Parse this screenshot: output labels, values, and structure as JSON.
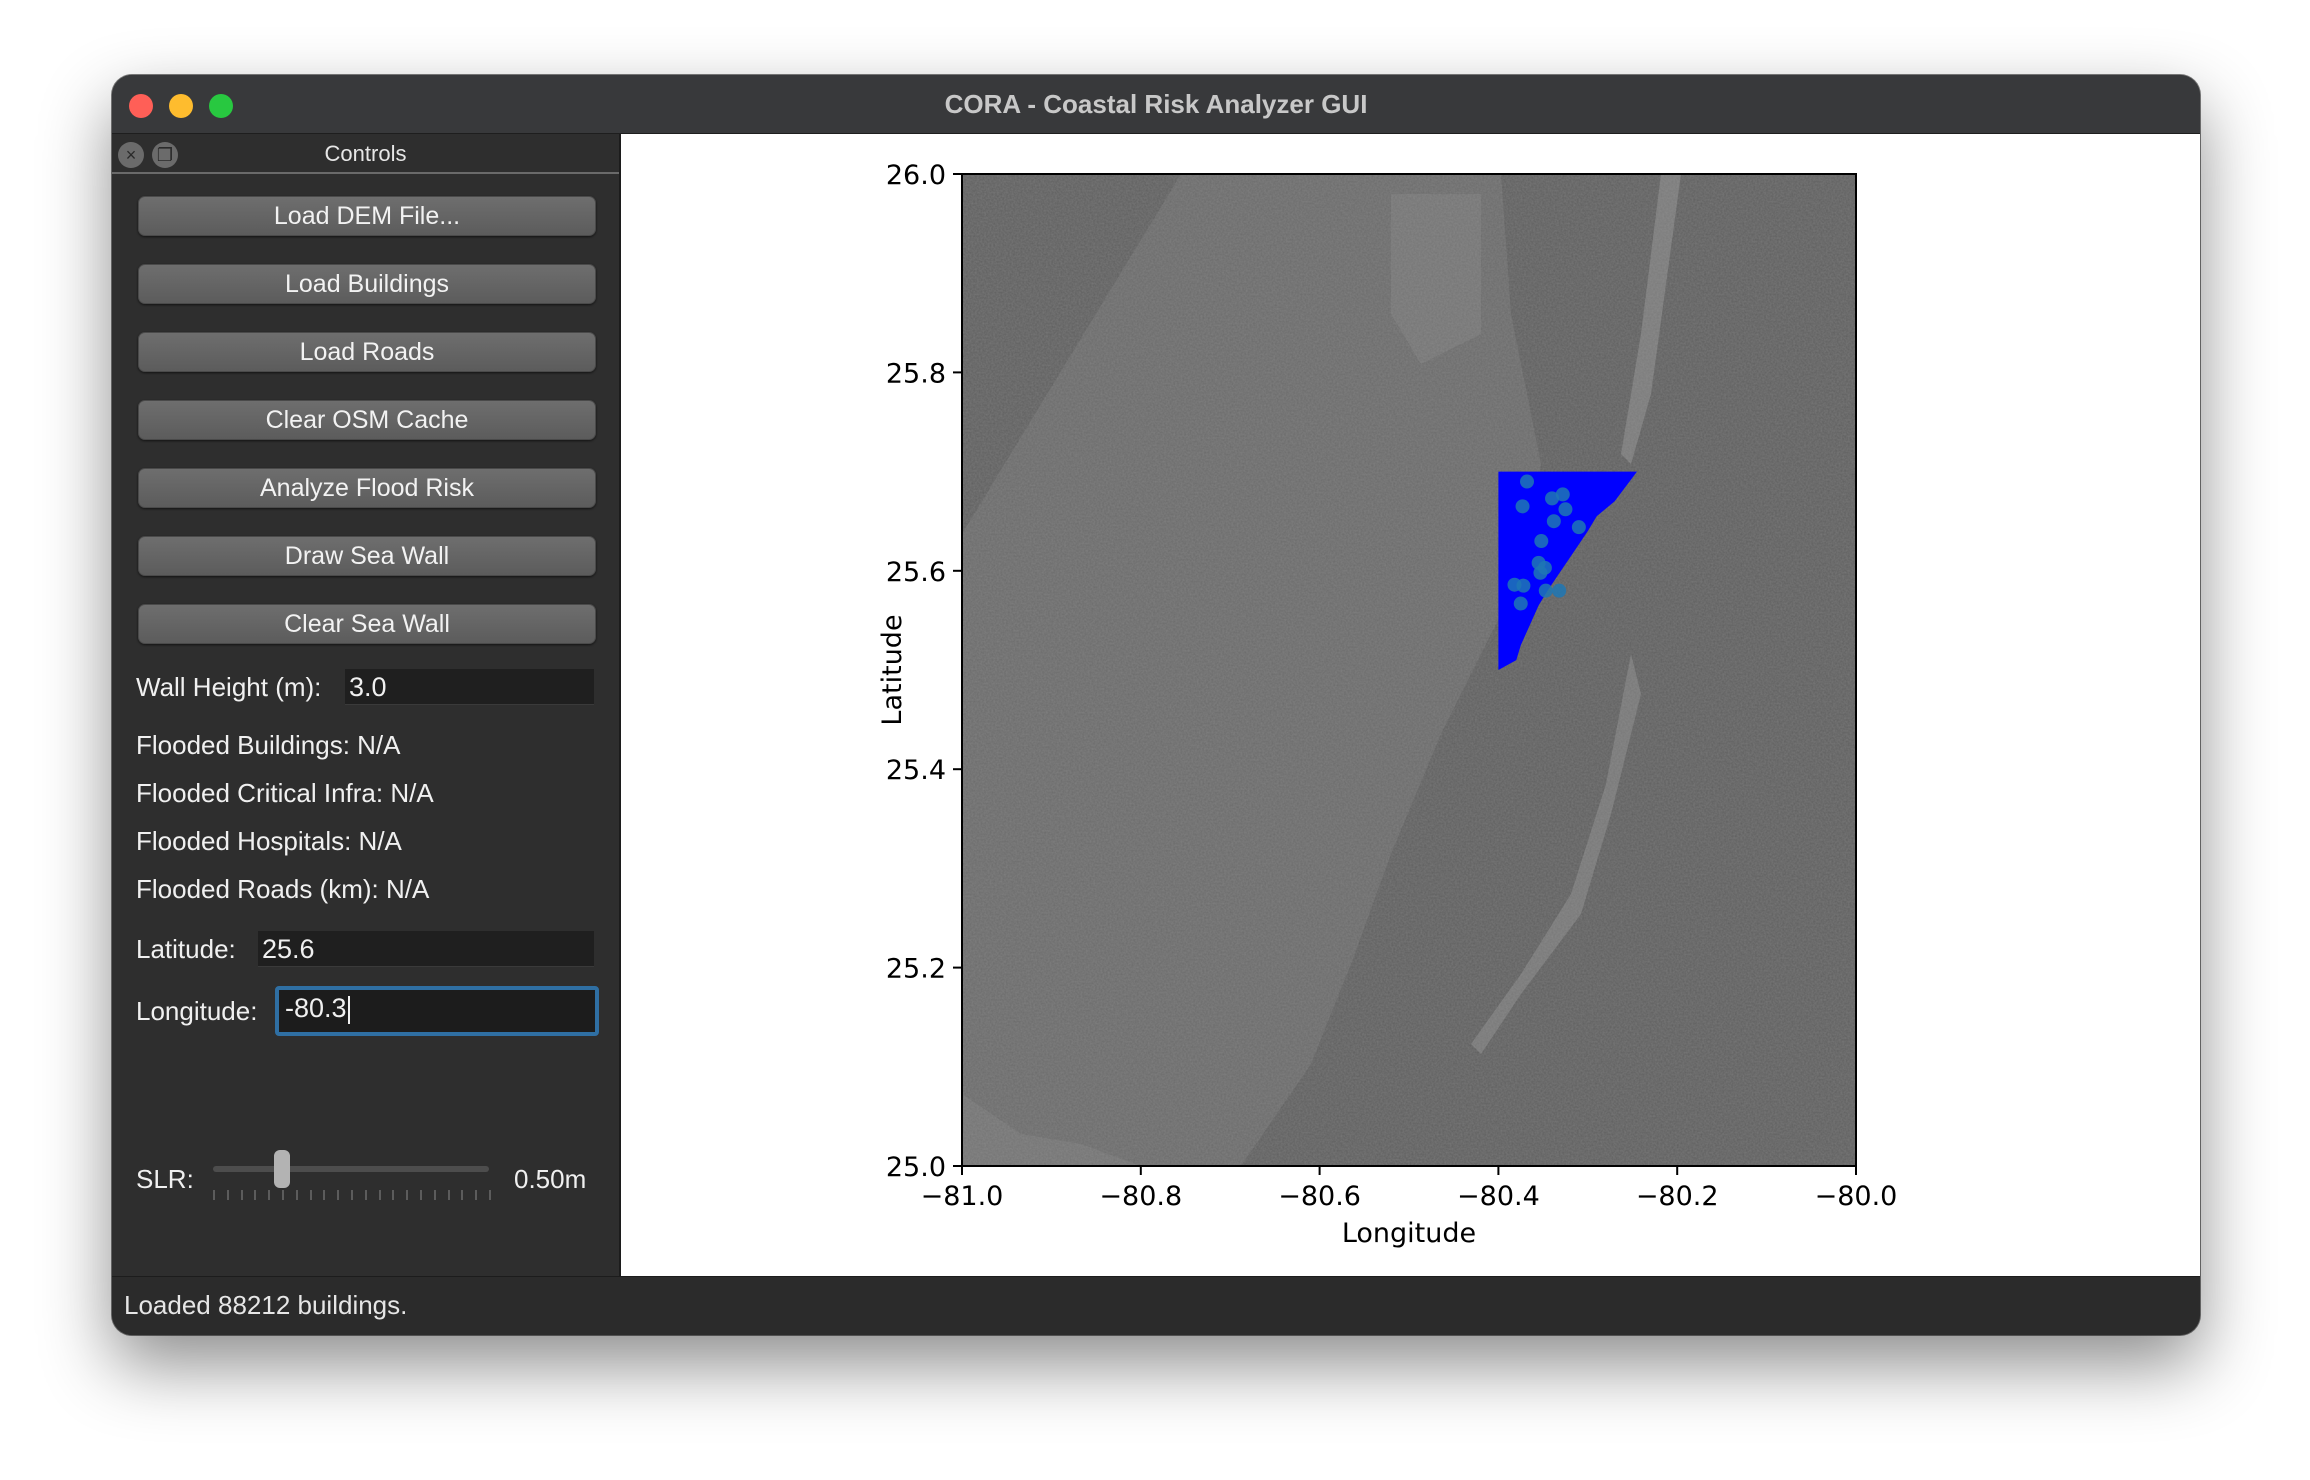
{
  "window": {
    "title": "CORA - Coastal Risk Analyzer GUI"
  },
  "controls": {
    "title": "Controls",
    "buttons": [
      "Load DEM File...",
      "Load Buildings",
      "Load Roads",
      "Clear OSM Cache",
      "Analyze Flood Risk",
      "Draw Sea Wall",
      "Clear Sea Wall"
    ],
    "wall_height": {
      "label": "Wall Height (m):",
      "value": "3.0"
    },
    "stats": [
      "Flooded Buildings: N/A",
      "Flooded Critical Infra: N/A",
      "Flooded Hospitals: N/A",
      "Flooded Roads (km): N/A"
    ],
    "latitude": {
      "label": "Latitude:",
      "value": "25.6"
    },
    "longitude": {
      "label": "Longitude:",
      "value": "-80.3"
    },
    "slr": {
      "label": "SLR:",
      "value_text": "0.50m",
      "level_fraction": 0.25
    }
  },
  "status": "Loaded 88212 buildings.",
  "chart_data": {
    "type": "map",
    "xlabel": "Longitude",
    "ylabel": "Latitude",
    "xlim": [
      -81.0,
      -80.0
    ],
    "ylim": [
      25.0,
      26.0
    ],
    "xticks": [
      -81.0,
      -80.8,
      -80.6,
      -80.4,
      -80.2,
      -80.0
    ],
    "xtick_labels": [
      "−81.0",
      "−80.8",
      "−80.6",
      "−80.4",
      "−80.2",
      "−80.0"
    ],
    "yticks": [
      25.0,
      25.2,
      25.4,
      25.6,
      25.8,
      26.0
    ],
    "ytick_labels": [
      "25.0",
      "25.2",
      "25.4",
      "25.6",
      "25.8",
      "26.0"
    ],
    "flood_region": {
      "color": "#0000ff",
      "polygon": [
        [
          -80.4,
          25.7
        ],
        [
          -80.245,
          25.7
        ],
        [
          -80.27,
          25.67
        ],
        [
          -80.29,
          25.655
        ],
        [
          -80.3,
          25.64
        ],
        [
          -80.315,
          25.62
        ],
        [
          -80.33,
          25.6
        ],
        [
          -80.345,
          25.58
        ],
        [
          -80.355,
          25.565
        ],
        [
          -80.365,
          25.545
        ],
        [
          -80.375,
          25.525
        ],
        [
          -80.38,
          25.51
        ],
        [
          -80.4,
          25.5
        ]
      ]
    },
    "markers": {
      "color": "#1f77b4",
      "points": [
        [
          -80.368,
          25.69
        ],
        [
          -80.373,
          25.665
        ],
        [
          -80.34,
          25.673
        ],
        [
          -80.328,
          25.677
        ],
        [
          -80.325,
          25.662
        ],
        [
          -80.338,
          25.65
        ],
        [
          -80.31,
          25.644
        ],
        [
          -80.352,
          25.63
        ],
        [
          -80.355,
          25.608
        ],
        [
          -80.348,
          25.603
        ],
        [
          -80.353,
          25.598
        ],
        [
          -80.382,
          25.586
        ],
        [
          -80.372,
          25.585
        ],
        [
          -80.375,
          25.567
        ],
        [
          -80.347,
          25.58
        ],
        [
          -80.332,
          25.58
        ]
      ]
    }
  }
}
